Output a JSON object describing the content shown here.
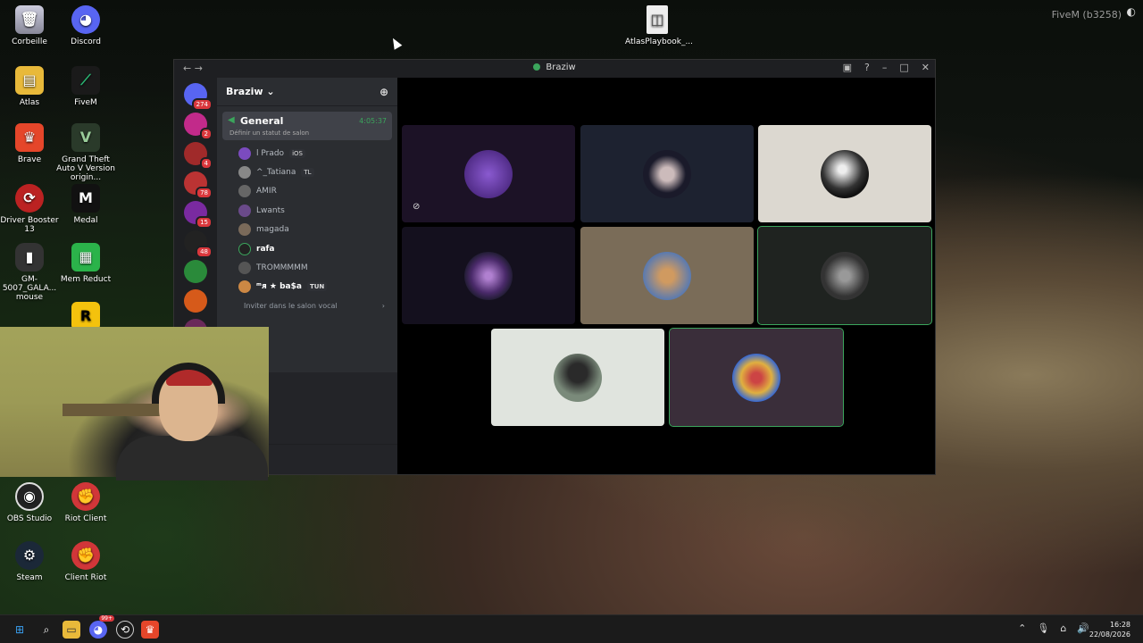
{
  "desktop": {
    "icons": [
      {
        "label": "Corbeille"
      },
      {
        "label": "Discord"
      },
      {
        "label": "Atlas"
      },
      {
        "label": "FiveM"
      },
      {
        "label": "Brave"
      },
      {
        "label": "Grand Theft Auto V Version origin..."
      },
      {
        "label": "Driver Booster 13"
      },
      {
        "label": "Medal"
      },
      {
        "label": "GM-5007_GALA... mouse"
      },
      {
        "label": "Mem Reduct"
      },
      {
        "label": "OBS Studio"
      },
      {
        "label": "Riot Client"
      },
      {
        "label": "Steam"
      },
      {
        "label": "Client Riot"
      },
      {
        "label": "AtlasPlaybook_..."
      }
    ],
    "fivem_tag": "FiveM (b3258)"
  },
  "discord": {
    "window_title": "Braziw",
    "server_badges": [
      "274",
      "2",
      "4",
      "78",
      "15",
      "48"
    ],
    "guild_name": "Braziw",
    "voice_channel": {
      "name": "General",
      "timer": "4:05:37",
      "status": "Définir un statut de salon"
    },
    "members": [
      {
        "name": "l Prado",
        "tag": "iOS",
        "color": "#7b4bbf"
      },
      {
        "name": "^_Tatiana",
        "tag": "TL",
        "color": "#888"
      },
      {
        "name": "AMIR",
        "tag": "",
        "color": "#666"
      },
      {
        "name": "Lwants",
        "tag": "",
        "color": "#6a4a8a"
      },
      {
        "name": "magada",
        "tag": "",
        "color": "#7a6a5a"
      },
      {
        "name": "rafa",
        "tag": "",
        "color": "#222"
      },
      {
        "name": "TROMMMMM",
        "tag": "",
        "color": "#555"
      },
      {
        "name": "ᵐᴙ ★ ba$a",
        "tag": "TUN",
        "color": "#c84"
      }
    ],
    "invite_label": "Inviter dans le salon vocal",
    "tiles": [
      {
        "bg": "#1c1226",
        "pic": "#5a3aa0"
      },
      {
        "bg": "#1d2230",
        "pic": "#2a2a3a"
      },
      {
        "bg": "#dcd8d0",
        "pic": "#444"
      },
      {
        "bg": "#14101e",
        "pic": "#4a2a6a"
      },
      {
        "bg": "#7a6c58",
        "pic": "#b08050"
      },
      {
        "bg": "#1f2320",
        "pic": "#888"
      },
      {
        "bg": "#e0e4de",
        "pic": "#556655"
      },
      {
        "bg": "#3a2e3a",
        "pic": "#c4a040"
      }
    ]
  },
  "taskbar": {
    "time": "16:28",
    "date": "22/08/2026",
    "discord_badge": "99+"
  }
}
